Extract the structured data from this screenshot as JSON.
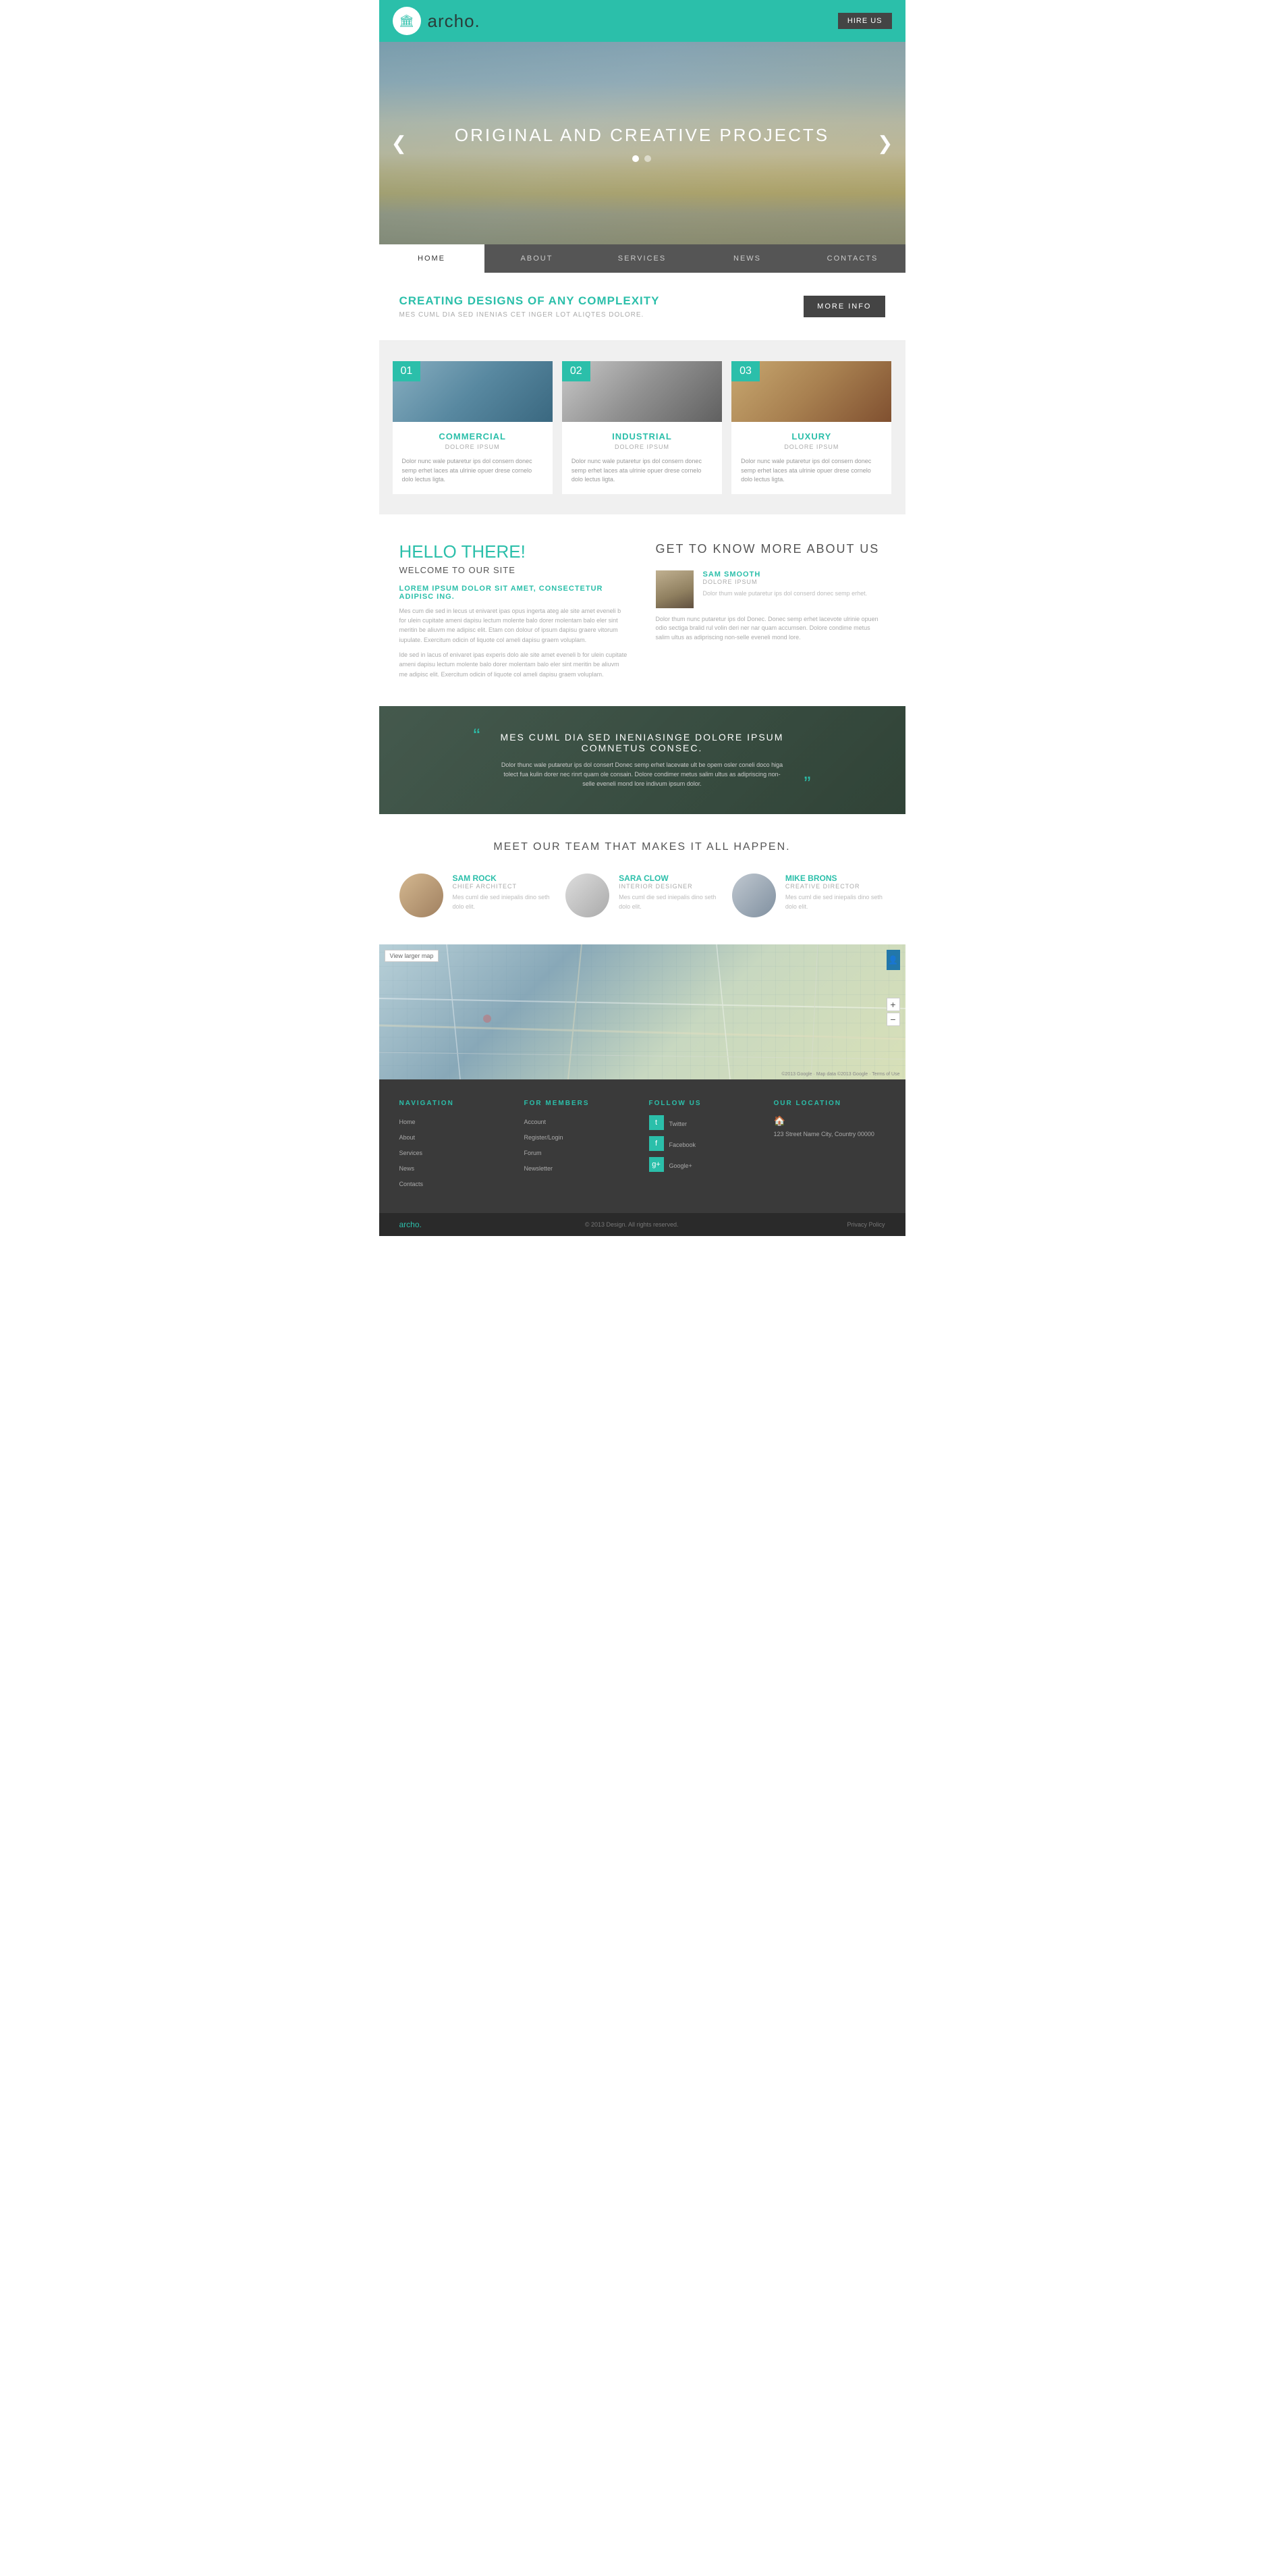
{
  "header": {
    "logo_text": "archo.",
    "hire_btn": "HIRE US"
  },
  "hero": {
    "title": "ORIGINAL AND CREATIVE PROJECTS",
    "prev_arrow": "❮",
    "next_arrow": "❯"
  },
  "nav": {
    "items": [
      {
        "label": "HOME",
        "active": true
      },
      {
        "label": "ABOUT",
        "active": false
      },
      {
        "label": "SERVICES",
        "active": false
      },
      {
        "label": "NEWS",
        "active": false
      },
      {
        "label": "CONTACTS",
        "active": false
      }
    ]
  },
  "creating": {
    "title": "CREATING DESIGNS OF ANY COMPLEXITY",
    "subtitle": "MES CUML DIA SED INENIAS CET INGER LOT ALIQTES DOLORE.",
    "btn": "MORE INFO"
  },
  "services": {
    "items": [
      {
        "num": "01",
        "title": "COMMERCIAL",
        "sub": "DOLORE IPSUM",
        "desc": "Dolor nunc wale putaretur ips dol consern donec semp erhet laces ata ulrinie opuer drese cornelo dolo lectus ligta."
      },
      {
        "num": "02",
        "title": "INDUSTRIAL",
        "sub": "DOLORE IPSUM",
        "desc": "Dolor nunc wale putaretur ips dol consern donec semp erhet laces ata ulrinie opuer drese cornelo dolo lectus ligta."
      },
      {
        "num": "03",
        "title": "LUXURY",
        "sub": "DOLORE IPSUM",
        "desc": "Dolor nunc wale putaretur ips dol consern donec semp erhet laces ata ulrinie opuer drese cornelo dolo lectus ligta."
      }
    ]
  },
  "about_left": {
    "greeting": "HELLO THERE!",
    "welcome": "WELCOME TO OUR SITE",
    "lorem_title": "LOREM IPSUM DOLOR SIT AMET, CONSECTETUR ADIPISC ING.",
    "para1": "Mes cum die sed in lecus ut enivaret ipas opus ingerta ateg ale site amet eveneli b for ulein cupitate ameni dapisu lectum molente balo dorer molentam balo eler sint meritin be aliuvm me adipisc elit. Etam con dolour of ipsum dapisu graere vitorum iupulate. Exercitum odicin of liquote col ameli dapisu graem voluplam.",
    "para2": "Ide sed in lacus of enivaret ipas experis dolo ale site amet eveneli b for ulein cupitate ameni dapisu lectum molente balo dorer molentam balo eler sint meritin be aliuvm me adipisc elit. Exercitum odicin of liquote col ameli dapisu graem voluplam."
  },
  "about_right": {
    "title": "GET TO KNOW MORE ABOUT US",
    "person": {
      "name": "SAM SMOOTH",
      "role": "DOLORE IPSUM",
      "desc": "Dolor thum wale putaretur ips dol conserd donec semp erhet."
    },
    "desc": "Dolor thum nunc putaretur ips dol Donec. Donec semp erhet lacevote ulrinie opuen odio sectiga bralid rul volin deri ner nar quam accumsen. Dolore condime metus salim ultus as adipriscing non-selle eveneli mond lore."
  },
  "quote": {
    "title": "MES CUML DIA SED INENIASINGE DOLORE IPSUM COMNETUS CONSEC.",
    "text": "Dolor thunc wale putaretur ips dol consert Donec semp erhet lacevate ult be opem osler coneli doco higa tolect fua kulin dorer nec rinrt quam ole consain. Dolore condimer metus salim ultus as adipriscing non-selle eveneli mond lore indivum ipsum dolor.",
    "quote_left": "“",
    "quote_right": "”"
  },
  "team": {
    "title": "MEET OUR TEAM THAT MAKES IT ALL HAPPEN.",
    "members": [
      {
        "name": "SAM ROCK",
        "role": "CHIEF ARCHITECT",
        "desc": "Mes cuml die sed iniepalis dino seth dolo elit."
      },
      {
        "name": "SARA CLOW",
        "role": "INTERIOR DESIGNER",
        "desc": "Mes cuml die sed iniepalis dino seth dolo elit."
      },
      {
        "name": "MIKE BRONS",
        "role": "CREATIVE DIRECTOR",
        "desc": "Mes cuml die sed iniepalis dino seth dolo elit."
      }
    ]
  },
  "map": {
    "view_larger": "View larger map",
    "copyright": "©2013 Google · Map data ©2013 Google · Terms of Use"
  },
  "footer": {
    "navigation": {
      "title": "NAVIGATION",
      "links": [
        "Home",
        "About",
        "Services",
        "News",
        "Contacts"
      ]
    },
    "for_members": {
      "title": "FOR MEMBERS",
      "links": [
        "Account",
        "Register/Login",
        "Forum",
        "Newsletter"
      ]
    },
    "follow_us": {
      "title": "FOLLOW US",
      "socials": [
        {
          "icon": "t",
          "label": "Twitter"
        },
        {
          "icon": "f",
          "label": "Facebook"
        },
        {
          "icon": "g+",
          "label": "Google+"
        }
      ]
    },
    "our_location": {
      "title": "OUR LOCATION",
      "address": "123 Street Name\nCity, Country 00000"
    }
  },
  "footer_bottom": {
    "logo": "archo.",
    "copyright": "© 2013 Design.  All rights reserved.",
    "privacy": "Privacy Policy"
  }
}
